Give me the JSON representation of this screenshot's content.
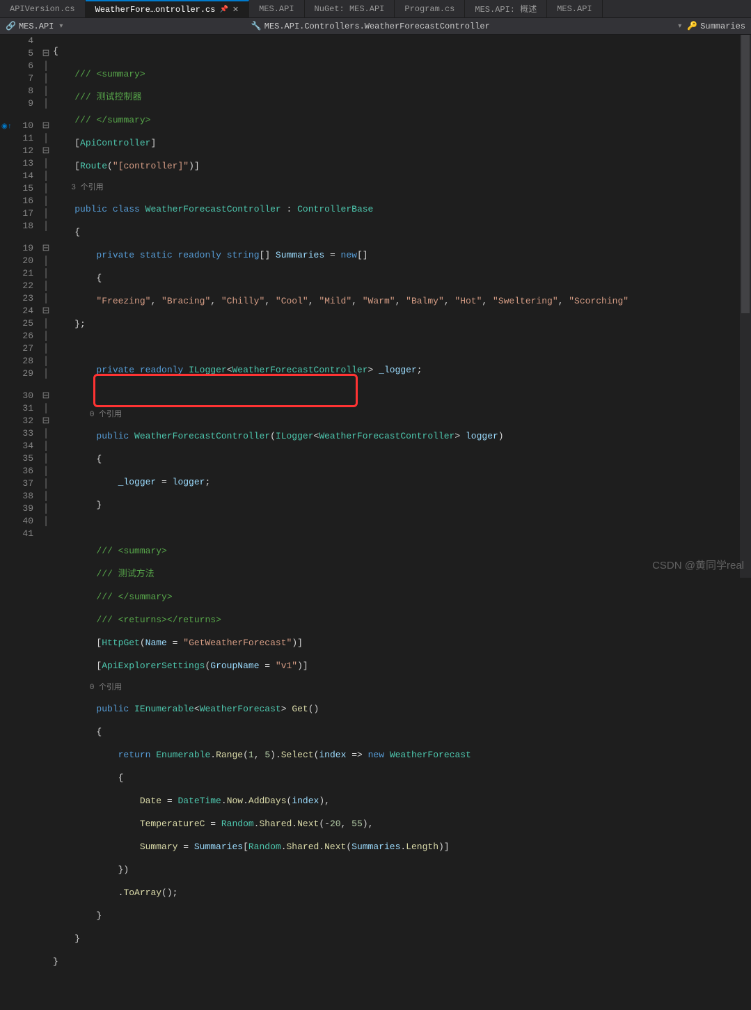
{
  "tabs": [
    {
      "label": "APIVersion.cs"
    },
    {
      "label": "WeatherFore…ontroller.cs",
      "active": true
    },
    {
      "label": "MES.API"
    },
    {
      "label": "NuGet: MES.API"
    },
    {
      "label": "Program.cs"
    },
    {
      "label": "MES.API: 概述"
    },
    {
      "label": "MES.API"
    }
  ],
  "nav": {
    "left": "MES.API",
    "center": "MES.API.Controllers.WeatherForecastController",
    "right": "Summaries"
  },
  "codelens": {
    "refs3": "3 个引用",
    "refs0a": "0 个引用",
    "refs0b": "0 个引用"
  },
  "code": {
    "l4": "{",
    "l5_slash": "/// ",
    "l5_tag": "<summary>",
    "l6_slash": "/// ",
    "l6_text": "测试控制器",
    "l7_slash": "/// ",
    "l7_tag": "</summary>",
    "l8_open": "[",
    "l8_attr": "ApiController",
    "l8_close": "]",
    "l9_open": "[",
    "l9_attr": "Route",
    "l9_paren": "(",
    "l9_str": "\"[controller]\"",
    "l9_close": ")]",
    "l10_kw1": "public",
    "l10_kw2": "class",
    "l10_name": "WeatherForecastController",
    "l10_colon": " : ",
    "l10_base": "ControllerBase",
    "l11": "{",
    "l12_kw1": "private",
    "l12_kw2": "static",
    "l12_kw3": "readonly",
    "l12_type": "string",
    "l12_brackets": "[] ",
    "l12_name": "Summaries",
    "l12_eq": " = ",
    "l12_new": "new",
    "l12_end": "[]",
    "l13": "{",
    "l14_s1": "\"Freezing\"",
    "l14_s2": "\"Bracing\"",
    "l14_s3": "\"Chilly\"",
    "l14_s4": "\"Cool\"",
    "l14_s5": "\"Mild\"",
    "l14_s6": "\"Warm\"",
    "l14_s7": "\"Balmy\"",
    "l14_s8": "\"Hot\"",
    "l14_s9": "\"Sweltering\"",
    "l14_s10": "\"Scorching\"",
    "l15": "};",
    "l17_kw1": "private",
    "l17_kw2": "readonly",
    "l17_type": "ILogger",
    "l17_lt": "<",
    "l17_gen": "WeatherForecastController",
    "l17_gt": "> ",
    "l17_name": "_logger",
    "l17_semi": ";",
    "l19_kw": "public",
    "l19_name": "WeatherForecastController",
    "l19_paren": "(",
    "l19_ptype": "ILogger",
    "l19_lt": "<",
    "l19_gen": "WeatherForecastController",
    "l19_gt": "> ",
    "l19_param": "logger",
    "l19_close": ")",
    "l20": "{",
    "l21_field": "_logger",
    "l21_eq": " = ",
    "l21_param": "logger",
    "l21_semi": ";",
    "l22": "}",
    "l24_slash": "/// ",
    "l24_tag": "<summary>",
    "l25_slash": "/// ",
    "l25_text": "测试方法",
    "l26_slash": "/// ",
    "l26_tag": "</summary>",
    "l27_slash": "/// ",
    "l27_tag": "<returns></returns>",
    "l28_open": "[",
    "l28_attr": "HttpGet",
    "l28_paren": "(",
    "l28_pname": "Name",
    "l28_eq": " = ",
    "l28_str": "\"GetWeatherForecast\"",
    "l28_close": ")]",
    "l29_open": "[",
    "l29_attr": "ApiExplorerSettings",
    "l29_paren": "(",
    "l29_pname": "GroupName",
    "l29_eq": " = ",
    "l29_str": "\"v1\"",
    "l29_close": ")]",
    "l30_kw": "public",
    "l30_type": "IEnumerable",
    "l30_lt": "<",
    "l30_gen": "WeatherForecast",
    "l30_gt": "> ",
    "l30_name": "Get",
    "l30_paren": "()",
    "l31": "{",
    "l32_kw": "return",
    "l32_type": "Enumerable",
    "l32_dot1": ".",
    "l32_m1": "Range",
    "l32_p1": "(",
    "l32_n1": "1",
    "l32_c1": ", ",
    "l32_n2": "5",
    "l32_p2": ").",
    "l32_m2": "Select",
    "l32_p3": "(",
    "l32_param": "index",
    "l32_arrow": " => ",
    "l32_new": "new",
    "l32_sp": " ",
    "l32_type2": "WeatherForecast",
    "l33": "{",
    "l34_prop": "Date",
    "l34_eq": " = ",
    "l34_type": "DateTime",
    "l34_dot": ".",
    "l34_now": "Now",
    "l34_dot2": ".",
    "l34_m": "AddDays",
    "l34_p": "(",
    "l34_param": "index",
    "l34_close": "),",
    "l35_prop": "TemperatureC",
    "l35_eq": " = ",
    "l35_type": "Random",
    "l35_dot": ".",
    "l35_shared": "Shared",
    "l35_dot2": ".",
    "l35_m": "Next",
    "l35_p": "(-",
    "l35_n1": "20",
    "l35_c": ", ",
    "l35_n2": "55",
    "l35_close": "),",
    "l36_prop": "Summary",
    "l36_eq": " = ",
    "l36_field": "Summaries",
    "l36_b": "[",
    "l36_type": "Random",
    "l36_dot": ".",
    "l36_shared": "Shared",
    "l36_dot2": ".",
    "l36_m": "Next",
    "l36_p": "(",
    "l36_field2": "Summaries",
    "l36_dot3": ".",
    "l36_len": "Length",
    "l36_close": ")]",
    "l37": "})",
    "l38_dot": ".",
    "l38_m": "ToArray",
    "l38_p": "();",
    "l39": "}",
    "l40": "}",
    "l41": "}"
  },
  "lines": [
    "4",
    "5",
    "6",
    "7",
    "8",
    "9",
    "10",
    "11",
    "12",
    "13",
    "14",
    "15",
    "16",
    "17",
    "18",
    "19",
    "20",
    "21",
    "22",
    "23",
    "24",
    "25",
    "26",
    "27",
    "28",
    "29",
    "30",
    "31",
    "32",
    "33",
    "34",
    "35",
    "36",
    "37",
    "38",
    "39",
    "40",
    "41"
  ],
  "watermark": "CSDN @黄同学real"
}
